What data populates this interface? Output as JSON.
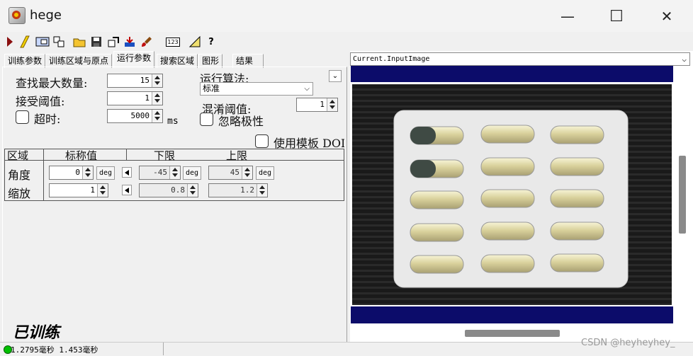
{
  "window": {
    "title": "hege",
    "minimize_glyph": "—",
    "maximize_glyph": "☐",
    "close_glyph": "✕"
  },
  "toolbar": {
    "icons": [
      "run-icon",
      "wand-icon",
      "display-icon",
      "copy-icon",
      "open-folder-icon",
      "save-icon",
      "export-icon",
      "import-icon",
      "brush-icon",
      "numbers-icon",
      "ruler-icon",
      "help-icon"
    ],
    "numbers_glyph": "123",
    "help_glyph": "?"
  },
  "tabs": [
    {
      "label": "训练参数"
    },
    {
      "label": "训练区域与原点"
    },
    {
      "label": "运行参数"
    },
    {
      "label": "搜索区域"
    },
    {
      "label": "图形"
    },
    {
      "label": "结果"
    }
  ],
  "params": {
    "max_count_label": "查找最大数量:",
    "max_count_value": "15",
    "accept_label": "接受阈值:",
    "accept_value": "1",
    "timeout_label": "超时:",
    "timeout_value": "5000",
    "timeout_unit": "ms",
    "algo_label": "运行算法:",
    "algo_value": "标准",
    "confusion_label": "混淆阈值:",
    "confusion_value": "1",
    "ignore_polarity_label": "忽略极性",
    "use_template_label": "使用模板 DOI"
  },
  "grid": {
    "headers": [
      "区域",
      "标称值",
      "下限",
      "上限"
    ],
    "rows": [
      {
        "name": "角度",
        "nominal": "0",
        "nominal_unit": "deg",
        "low": "-45",
        "low_unit": "deg",
        "high": "45",
        "high_unit": "deg"
      },
      {
        "name": "缩放",
        "nominal": "1",
        "low": "0.8",
        "high": "1.2"
      }
    ]
  },
  "status": {
    "trained_label": "已训练",
    "timing_text": "1.2795毫秒 1.453毫秒",
    "indicator_color": "#00c000"
  },
  "viewer": {
    "image_title": "Current.InputImage",
    "band_color": "#0c0c6a"
  },
  "watermark": "CSDN @heyheyhey_"
}
